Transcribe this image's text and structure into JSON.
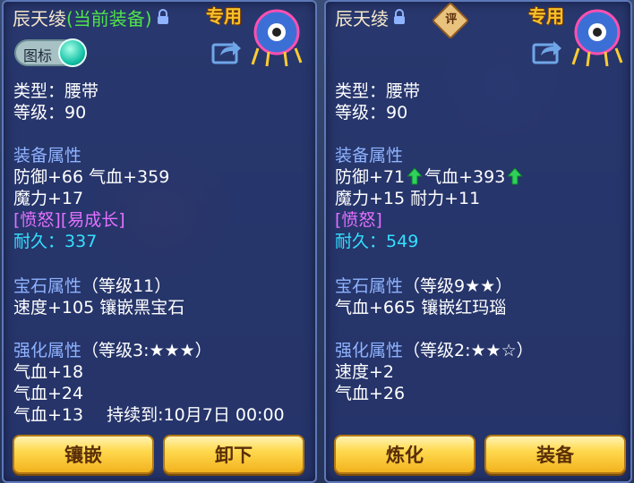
{
  "left_panel": {
    "name": "辰天绫",
    "equipped_tag": "(当前装备)",
    "exclusive": "专用",
    "icon_toggle_label": "图标",
    "type_line": "类型：腰带",
    "level_line": "等级：90",
    "equip_attr_header": "装备属性",
    "attr_line1": "防御+66 气血+359",
    "attr_line2": "魔力+17",
    "special_line": "[愤怒][易成长]",
    "durability_label": "耐久：",
    "durability_value": "337",
    "gem_header": "宝石属性",
    "gem_level": "（等级11）",
    "gem_line": "速度+105 镶嵌黑宝石",
    "enhance_header": "强化属性",
    "enhance_level": "（等级3:★★★）",
    "enhance_line1": "气血+18",
    "enhance_line2": "气血+24",
    "enhance_line3": "气血+13",
    "enhance_expire": "持续到:10月7日 00:00",
    "btn_inlay": "镶嵌",
    "btn_unequip": "卸下"
  },
  "right_panel": {
    "name": "辰天绫",
    "rate_badge": "评",
    "exclusive": "专用",
    "type_line": "类型：腰带",
    "level_line": "等级：90",
    "equip_attr_header": "装备属性",
    "attr_def": "防御+71",
    "attr_hp": "气血+393",
    "attr_line2": "魔力+15 耐力+11",
    "special_line": "[愤怒]",
    "durability_label": "耐久：",
    "durability_value": "549",
    "gem_header": "宝石属性",
    "gem_level": "（等级9★★）",
    "gem_line": "气血+665 镶嵌红玛瑙",
    "enhance_header": "强化属性",
    "enhance_level": "（等级2:★★☆）",
    "enhance_line1": "速度+2",
    "enhance_line2": "气血+26",
    "btn_refine": "炼化",
    "btn_equip": "装备"
  }
}
